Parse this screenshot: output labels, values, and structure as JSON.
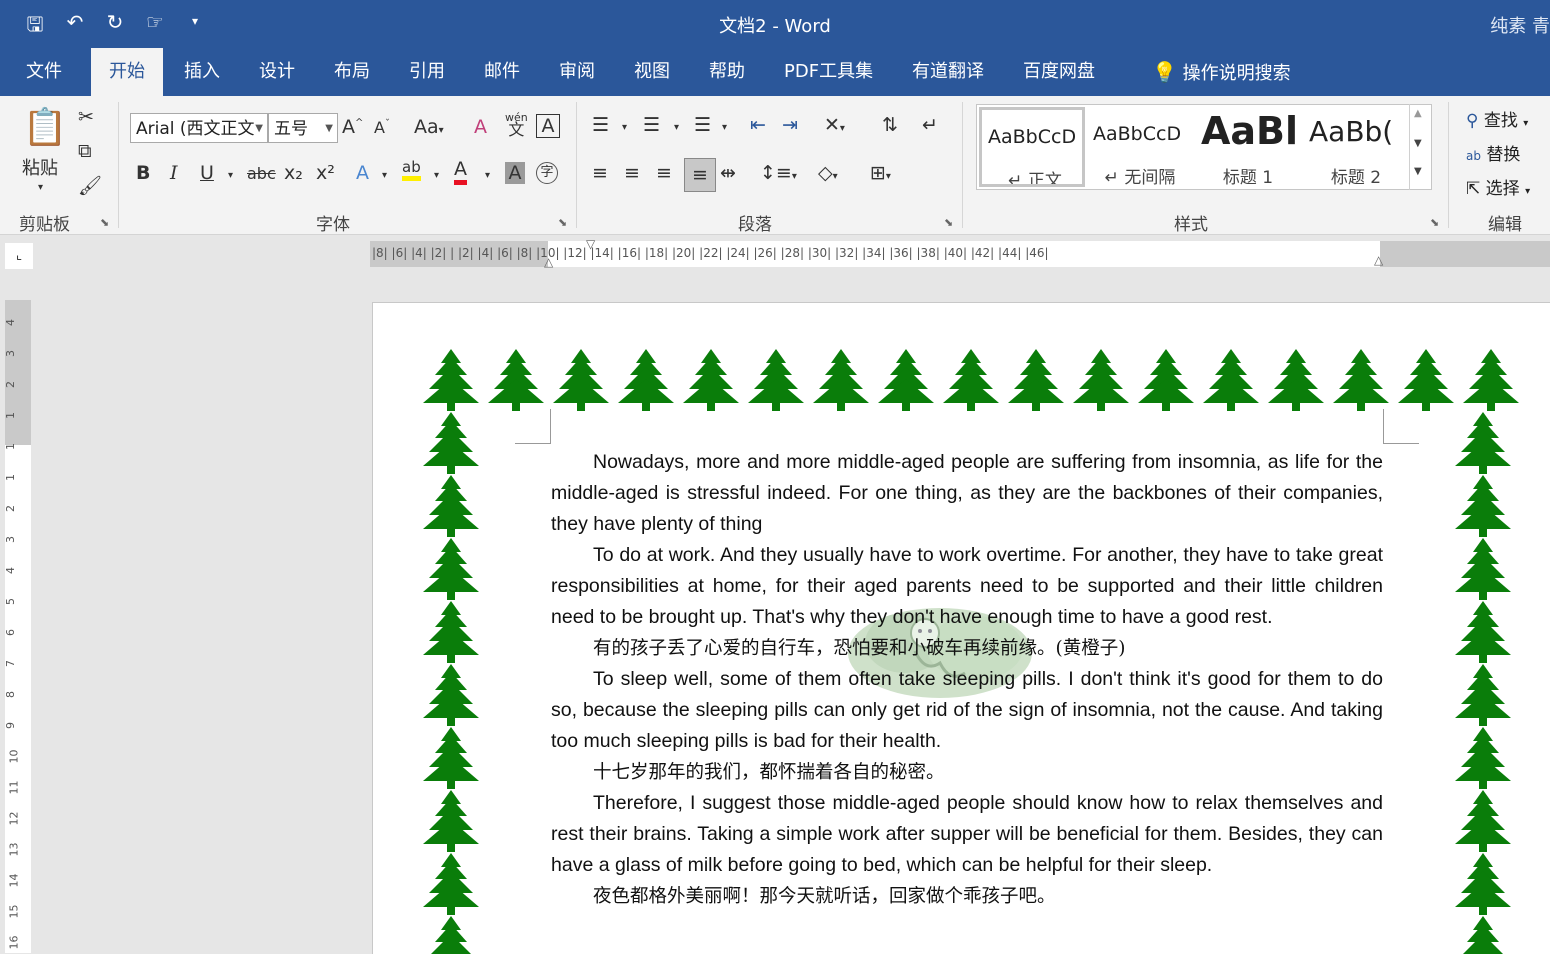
{
  "title_bar": {
    "document_title": "文档2  -  Word",
    "user": "纯素 青",
    "qat_icons": [
      "save-icon",
      "undo-icon",
      "redo-icon",
      "touch-mode-icon",
      "customize-qat-icon"
    ]
  },
  "tabs": [
    {
      "label": "文件"
    },
    {
      "label": "开始"
    },
    {
      "label": "插入"
    },
    {
      "label": "设计"
    },
    {
      "label": "布局"
    },
    {
      "label": "引用"
    },
    {
      "label": "邮件"
    },
    {
      "label": "审阅"
    },
    {
      "label": "视图"
    },
    {
      "label": "帮助"
    },
    {
      "label": "PDF工具集"
    },
    {
      "label": "有道翻译"
    },
    {
      "label": "百度网盘"
    },
    {
      "label": "操作说明搜索"
    }
  ],
  "active_tab": "开始",
  "ribbon": {
    "clipboard": {
      "group_label": "剪贴板",
      "paste_label": "粘贴"
    },
    "font": {
      "group_label": "字体",
      "font_name": "Arial (西文正文",
      "font_size": "五号",
      "buttons": [
        "B",
        "I",
        "U",
        "abc",
        "x₂",
        "x²",
        "A",
        "ab",
        "A",
        "A",
        "字",
        "Aa",
        "A"
      ],
      "phonetic_label": "wén",
      "phonetic_char": "文"
    },
    "paragraph": {
      "group_label": "段落"
    },
    "styles": {
      "group_label": "样式",
      "items": [
        {
          "preview": "AaBbCcD",
          "name": "↵ 正文"
        },
        {
          "preview": "AaBbCcD",
          "name": "↵ 无间隔"
        },
        {
          "preview": "AaBl",
          "name": "标题 1"
        },
        {
          "preview": "AaBb(",
          "name": "标题 2"
        }
      ]
    },
    "editing": {
      "group_label": "编辑",
      "find": "查找",
      "replace": "替换",
      "select": "选择"
    }
  },
  "ruler": {
    "h_labels": "|8|  |6|  |4|  |2|  |  |2|  |4|  |6|  |8|  |10|  |12|  |14|  |16|  |18|  |20|  |22|  |24|  |26|  |28|  |30|  |32|  |34|  |36|  |38|  |40|  |42|  |44|  |46|",
    "v_labels": [
      "4",
      "3",
      "2",
      "1",
      "1",
      "1",
      "2",
      "3",
      "4",
      "5",
      "6",
      "7",
      "8",
      "9",
      "10",
      "11",
      "12",
      "13",
      "14",
      "15",
      "16"
    ]
  },
  "document": {
    "paragraphs": [
      {
        "text": "Nowadays, more and more middle-aged people are suffering from insomnia, as life for the middle-aged is stressful indeed. For one thing, as they are the backbones of their companies, they have plenty of thing",
        "lang": "en"
      },
      {
        "text": "To do at work. And they usually have to work overtime. For another, they have to take great responsibilities at home, for their aged parents need to be supported and their little children need to be brought up. That's why they don't have enough time to have a good rest.",
        "lang": "en"
      },
      {
        "text": "有的孩子丢了心爱的自行车，恐怕要和小破车再续前缘。(黄橙子)",
        "lang": "cn"
      },
      {
        "text": "To sleep well, some of them often take sleeping pills. I don't think it's good for them to do so, because the sleeping pills can only get rid of the sign of insomnia, not the cause. And taking too much sleeping pills is bad for their health.",
        "lang": "en"
      },
      {
        "text": "十七岁那年的我们，都怀揣着各自的秘密。",
        "lang": "cn"
      },
      {
        "text": "Therefore, I suggest those middle-aged people should know how to relax themselves and rest their brains. Taking a simple work after supper will be beneficial for them. Besides, they can have a glass of milk before going to bed, which can be helpful for their sleep.",
        "lang": "en"
      },
      {
        "text": "夜色都格外美丽啊！那今天就听话，回家做个乖孩子吧。",
        "lang": "cn"
      }
    ]
  },
  "colors": {
    "word_blue": "#2b579a",
    "tree_green": "#0a7d0a",
    "ribbon_bg": "#f3f3f3"
  }
}
